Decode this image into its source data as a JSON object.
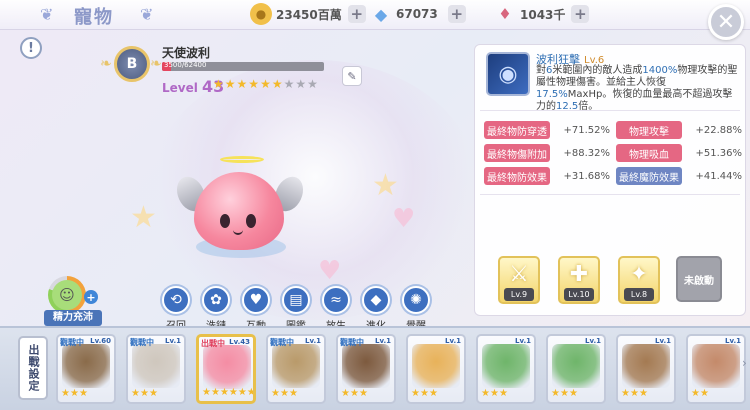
{
  "header": {
    "title": "寵物",
    "resources": [
      {
        "icon": "gold-coin-icon",
        "value": "23450百萬"
      },
      {
        "icon": "diamond-icon",
        "value": "67073"
      },
      {
        "icon": "crystal-icon",
        "value": "1043千"
      }
    ],
    "close": "✕"
  },
  "pet": {
    "rank": "B",
    "name": "天使波利",
    "exp_text": "3500/62400",
    "exp_progress": 0.056,
    "level_prefix": "Level",
    "level": "43",
    "stars_filled": 6,
    "stars_total": 9
  },
  "stamina": {
    "label": "精力充沛"
  },
  "actions": [
    {
      "id": "recall",
      "label": "召回",
      "icon": "recall-icon",
      "glyph": "⟲"
    },
    {
      "id": "wash",
      "label": "洗鏈",
      "icon": "wash-icon",
      "glyph": "✿"
    },
    {
      "id": "interact",
      "label": "互動",
      "icon": "heart-icon",
      "glyph": "♥"
    },
    {
      "id": "album",
      "label": "圖鑑",
      "icon": "book-icon",
      "glyph": "▤"
    },
    {
      "id": "release",
      "label": "放生",
      "icon": "fish-icon",
      "glyph": "≈"
    },
    {
      "id": "evolve",
      "label": "進化",
      "icon": "crystal-icon",
      "glyph": "◆"
    },
    {
      "id": "awaken",
      "label": "覺醒",
      "icon": "star-burst-icon",
      "glyph": "✺"
    }
  ],
  "skill": {
    "name": "波利狂擊",
    "level": "Lv.6",
    "desc_parts": [
      {
        "t": "對",
        "hl": false
      },
      {
        "t": "6",
        "hl": true
      },
      {
        "t": "米範圍內的敵人造成",
        "hl": false
      },
      {
        "t": "1400%",
        "hl": true
      },
      {
        "t": "物理攻擊的聖屬性物理傷害。並給主人恢復",
        "hl": false
      },
      {
        "t": "17.5%",
        "hl": true
      },
      {
        "t": "MaxHp。恢復的血量最高不超過攻擊力的",
        "hl": false
      },
      {
        "t": "12.5",
        "hl": true
      },
      {
        "t": "倍。",
        "hl": false
      }
    ]
  },
  "stats": [
    {
      "name": "最終物防穿透",
      "value": "+71.52%",
      "color": "#e56783"
    },
    {
      "name": "物理攻擊",
      "value": "+22.88%",
      "color": "#e56783"
    },
    {
      "name": "最終物傷附加",
      "value": "+88.32%",
      "color": "#e56783"
    },
    {
      "name": "物理吸血",
      "value": "+51.36%",
      "color": "#e56783"
    },
    {
      "name": "最終物防效果",
      "value": "+31.68%",
      "color": "#e56783"
    },
    {
      "name": "最終魔防效果",
      "value": "+41.44%",
      "color": "#6f86c3"
    }
  ],
  "skill_slots": [
    {
      "level": "Lv.9",
      "glyph": "⚔"
    },
    {
      "level": "Lv.10",
      "glyph": "✚"
    },
    {
      "level": "Lv.8",
      "glyph": "✦"
    }
  ],
  "unlock_label": "未啟動",
  "roster": {
    "set_label": "出戰設定",
    "cards": [
      {
        "tag": "觀戰中",
        "lv": "Lv.60",
        "stars": 3,
        "color": "#8a6b4a",
        "sel": false
      },
      {
        "tag": "觀戰中",
        "lv": "Lv.1",
        "stars": 3,
        "color": "#cfc7bd",
        "sel": false
      },
      {
        "tag": "出戰中",
        "lv": "Lv.43",
        "stars": 6,
        "color": "#f48da4",
        "sel": true
      },
      {
        "tag": "觀戰中",
        "lv": "Lv.1",
        "stars": 3,
        "color": "#b99a6a",
        "sel": false
      },
      {
        "tag": "觀戰中",
        "lv": "Lv.1",
        "stars": 3,
        "color": "#7d5a3e",
        "sel": false
      },
      {
        "tag": "",
        "lv": "Lv.1",
        "stars": 3,
        "color": "#e8b25a",
        "sel": false
      },
      {
        "tag": "",
        "lv": "Lv.1",
        "stars": 3,
        "color": "#6fb56a",
        "sel": false
      },
      {
        "tag": "",
        "lv": "Lv.1",
        "stars": 3,
        "color": "#6fb56a",
        "sel": false
      },
      {
        "tag": "",
        "lv": "Lv.1",
        "stars": 3,
        "color": "#a47a52",
        "sel": false
      },
      {
        "tag": "",
        "lv": "Lv.1",
        "stars": 2,
        "color": "#c48a6a",
        "sel": false
      }
    ]
  }
}
